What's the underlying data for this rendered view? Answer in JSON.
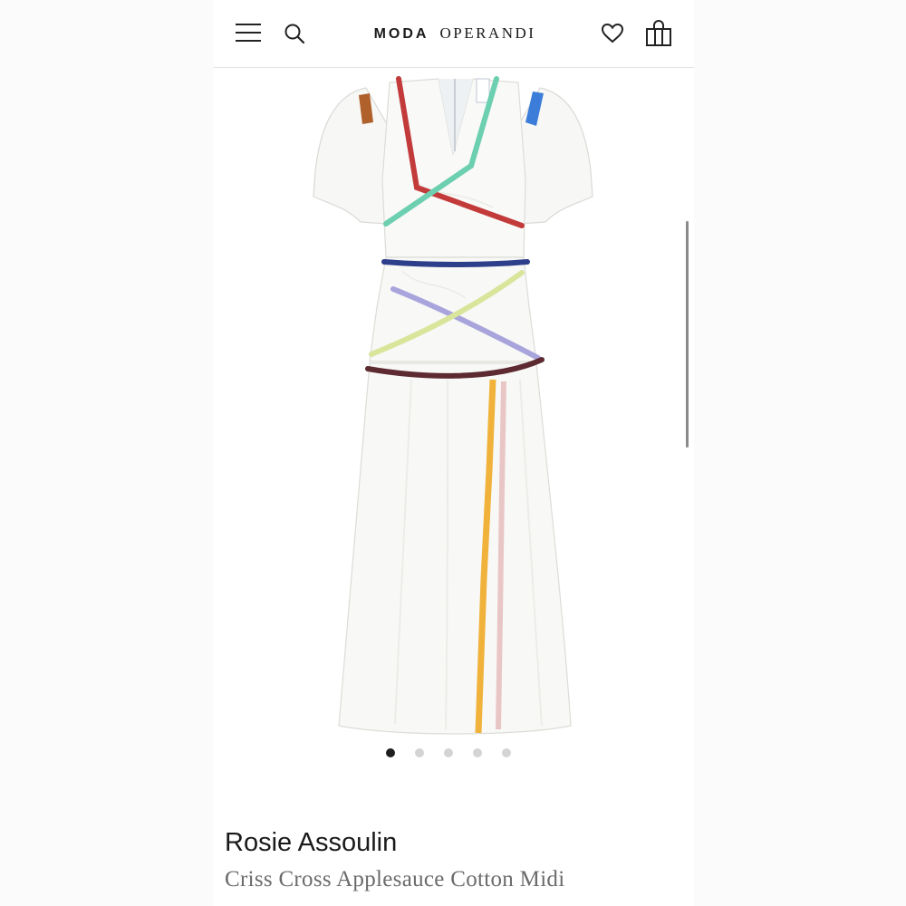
{
  "header": {
    "brand_left": "MODA",
    "brand_right": "OPERANDI",
    "icons": [
      "menu-icon",
      "search-icon",
      "heart-icon",
      "shopping-bag-icon"
    ]
  },
  "gallery": {
    "image_count": 5,
    "active_index": 0
  },
  "product": {
    "designer": "Rosie Assoulin",
    "name": "Criss Cross Applesauce Cotton Midi"
  },
  "colors": {
    "text_primary": "#1a1a1a",
    "text_secondary": "#6b6b6b",
    "dot_active": "#1f1f1f",
    "dot_inactive": "#d4d4d4"
  }
}
